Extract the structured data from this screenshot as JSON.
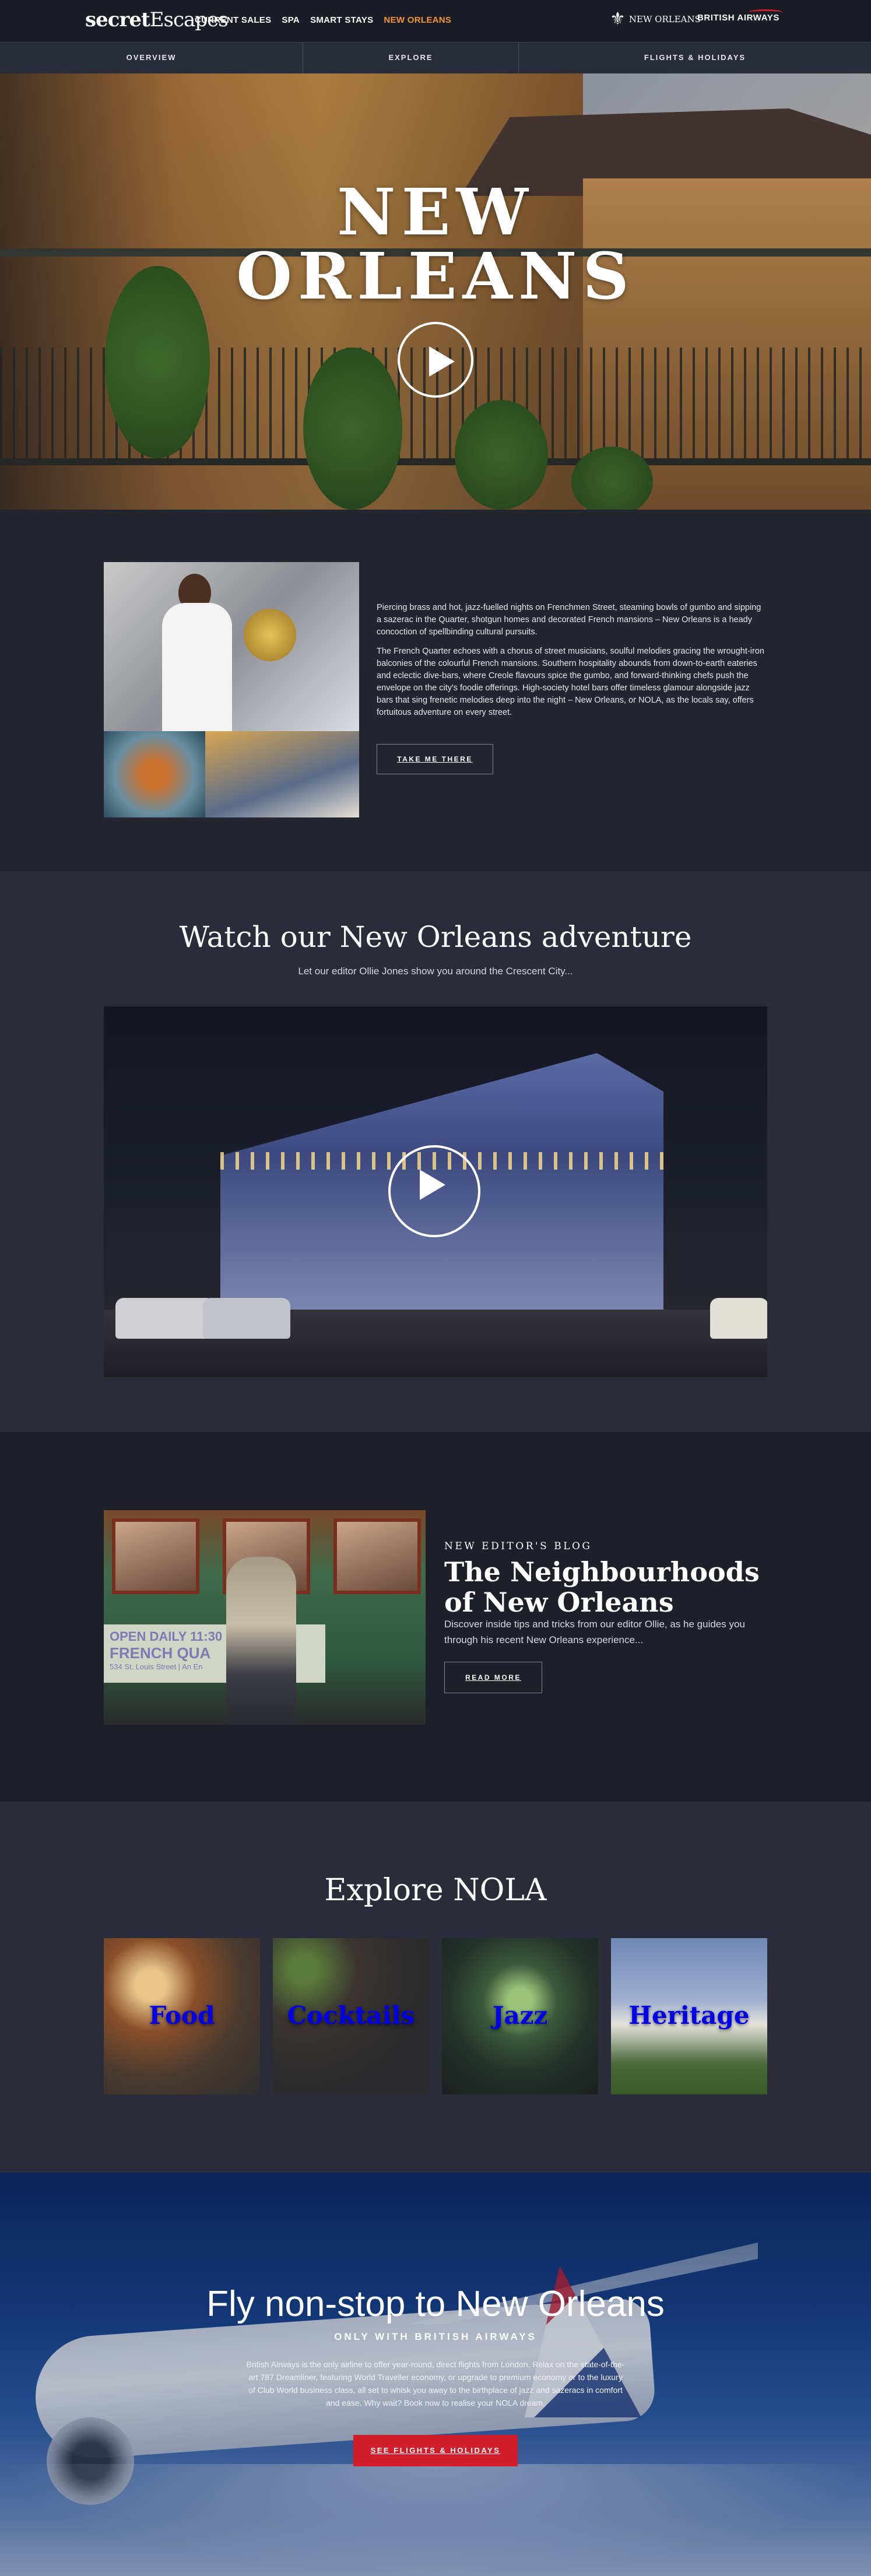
{
  "header": {
    "logo_bold": "secret",
    "logo_thin": "Escapes",
    "nav": [
      "CURRENT SALES",
      "SPA",
      "SMART STAYS",
      "NEW ORLEANS"
    ],
    "partner_neworleans": "NEW ORLEANS",
    "partner_ba": "BRITISH AIRWAYS"
  },
  "subnav": [
    "OVERVIEW",
    "EXPLORE",
    "FLIGHTS & HOLIDAYS"
  ],
  "hero": {
    "title_line1": "NEW",
    "title_line2": "ORLEANS"
  },
  "intro": {
    "paragraph1": "Piercing brass and hot, jazz-fuelled nights on Frenchmen Street, steaming bowls of gumbo and sipping a sazerac in the Quarter, shotgun homes and decorated French mansions – New Orleans is a heady concoction of spellbinding cultural pursuits.",
    "paragraph2": "The French Quarter echoes with a chorus of street musicians, soulful melodies gracing the wrought-iron balconies of the colourful French mansions. Southern hospitality abounds from down-to-earth eateries and eclectic dive-bars, where Creole flavours spice the gumbo, and forward-thinking chefs push the envelope on the city's foodie offerings. High-society hotel bars offer timeless glamour alongside jazz bars that sing frenetic melodies deep into the night – New Orleans, or NOLA, as the locals say, offers fortuitous adventure on every street.",
    "button": "TAKE ME THERE"
  },
  "video": {
    "title": "Watch our New Orleans adventure",
    "subtitle": "Let our editor Ollie Jones show you around the Crescent City..."
  },
  "blog": {
    "kicker": "NEW EDITOR'S BLOG",
    "title": "The Neighbourhoods of New Orleans",
    "text": "Discover inside tips and tricks from our editor Ollie, as he guides you through his recent New Orleans experience...",
    "button": "READ MORE",
    "sign_line1": "OPEN DAILY 11:30",
    "sign_line2": "FRENCH QUA",
    "sign_line3": "534 St. Louis Street | An En"
  },
  "explore": {
    "title": "Explore NOLA",
    "tiles": [
      "Food",
      "Cocktails",
      "Jazz",
      "Heritage"
    ]
  },
  "ba": {
    "title": "Fly non-stop to New Orleans",
    "tagline": "ONLY WITH BRITISH AIRWAYS",
    "copy": "British Airways is the only airline to offer year-round, direct flights from London. Relax on the state-of-the-art 787 Dreamliner, featuring World Traveller economy, or upgrade to premium economy or to the luxury of Club World business class, all set to whisk you away to the birthplace of jazz and sazeracs in comfort and ease. Why wait? Book now to realise your NOLA dream.",
    "button": "SEE FLIGHTS & HOLIDAYS"
  }
}
